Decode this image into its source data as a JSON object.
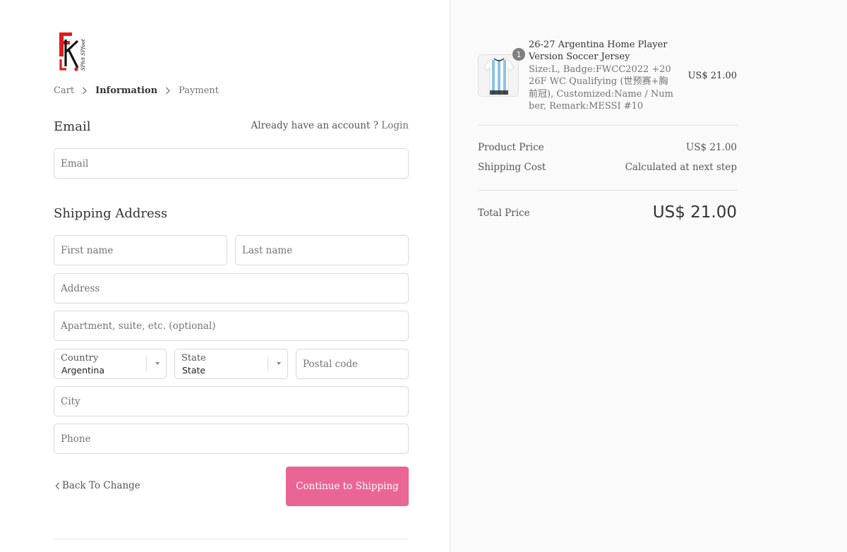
{
  "logo": {
    "alt": "FR Sports Spot logo",
    "text": "SPhit SPfoot"
  },
  "breadcrumb": {
    "items": [
      {
        "label": "Cart",
        "current": false
      },
      {
        "label": "Information",
        "current": true
      },
      {
        "label": "Payment",
        "current": false
      }
    ]
  },
  "email_section": {
    "title": "Email",
    "login_prompt": "Already have an account ?",
    "login_link": "Login",
    "email_placeholder": "Email"
  },
  "shipping": {
    "title": "Shipping Address",
    "first_name_placeholder": "First name",
    "last_name_placeholder": "Last name",
    "address_placeholder": "Address",
    "apartment_placeholder": "Apartment, suite, etc. (optional)",
    "country_label": "Country",
    "country_value": "Argentina",
    "state_label": "State",
    "state_value": "State",
    "postal_placeholder": "Postal code",
    "city_placeholder": "City",
    "phone_placeholder": "Phone"
  },
  "actions": {
    "back_label": "Back To Change",
    "continue_label": "Continue to Shipping",
    "continue_color": "#ea6595"
  },
  "order": {
    "item": {
      "quantity": "1",
      "title": "26-27 Argentina Home Player Version Soccer Jersey",
      "variant": "Size:L, Badge:FWCC2022 +2026F WC Qualifying (世预赛+胸前冠), Customized:Name / Number, Remark:MESSI #10",
      "price": "US$ 21.00"
    },
    "product_price_label": "Product Price",
    "product_price_value": "US$ 21.00",
    "shipping_cost_label": "Shipping Cost",
    "shipping_cost_value": "Calculated at next step",
    "total_label": "Total Price",
    "total_value": "US$ 21.00"
  }
}
